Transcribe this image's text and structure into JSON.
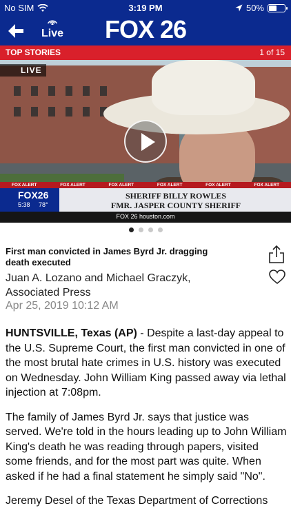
{
  "status_bar": {
    "carrier": "No SIM",
    "time": "3:19 PM",
    "battery": "50%"
  },
  "header": {
    "logo": "FOX 26",
    "live_label": "Live"
  },
  "section": {
    "title": "TOP STORIES",
    "count": "1 of 15"
  },
  "video": {
    "live_tag": "LIVE",
    "alert_label": "FOX ALERT",
    "lower_third": {
      "name": "SHERIFF BILLY ROWLES",
      "title": "FMR. JASPER COUNTY SHERIFF",
      "logo": "FOX26",
      "time": "5:38",
      "temp": "78°",
      "url": "FOX 26 houston.com"
    }
  },
  "pager": {
    "total": 4,
    "active": 1
  },
  "article": {
    "headline": "First man convicted in James Byrd Jr. dragging death executed",
    "byline": "Juan A. Lozano and Michael Graczyk, Associated Press",
    "date": "Apr 25, 2019 10:12 AM",
    "paragraphs": [
      {
        "lead": "HUNTSVILLE, Texas (AP)",
        "text": " - Despite a last-day appeal to the U.S. Supreme Court, the first man convicted in one of the most brutal hate crimes in U.S. history was executed on Wednesday. John William King passed away via lethal injection at 7:08pm."
      },
      {
        "lead": "",
        "text": "The family of James Byrd Jr. says that justice was served. We're told in the hours leading up to John William King's death he was reading through papers, visited some friends, and for the most part was quite. When asked if he had a final statement he simply said \"No\"."
      },
      {
        "lead": "",
        "text": "Jeremy Desel of the Texas Department of Corrections"
      }
    ]
  },
  "icons": {
    "back": "back-arrow-icon",
    "live": "broadcast-icon",
    "share": "share-icon",
    "favorite": "heart-icon",
    "play": "play-icon"
  }
}
